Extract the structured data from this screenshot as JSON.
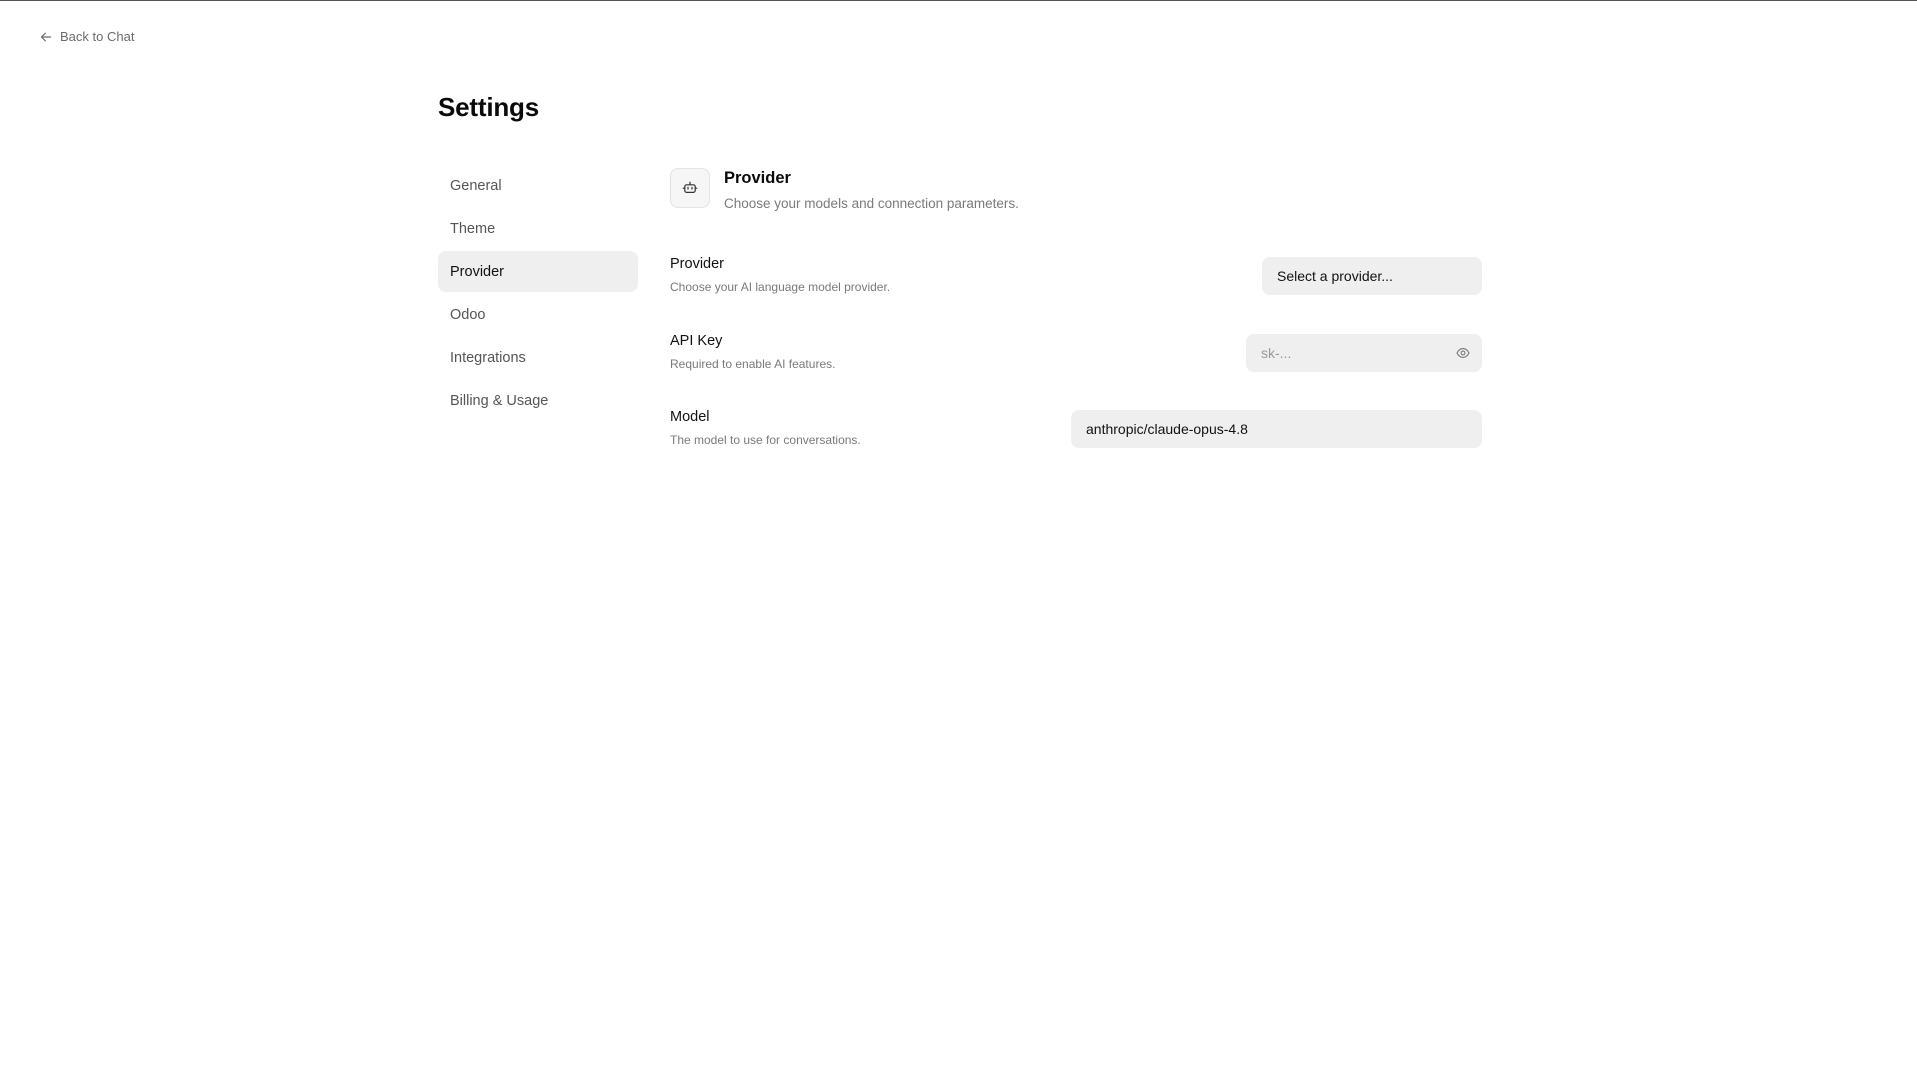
{
  "nav": {
    "back_label": "Back to Chat"
  },
  "page": {
    "title": "Settings"
  },
  "sidebar": {
    "items": [
      {
        "label": "General"
      },
      {
        "label": "Theme"
      },
      {
        "label": "Provider",
        "active": true
      },
      {
        "label": "Odoo"
      },
      {
        "label": "Integrations"
      },
      {
        "label": "Billing & Usage"
      }
    ]
  },
  "section": {
    "icon": "bot-icon",
    "title": "Provider",
    "description": "Choose your models and connection parameters."
  },
  "fields": {
    "provider": {
      "label": "Provider",
      "help": "Choose your AI language model provider.",
      "value": "Select a provider..."
    },
    "api_key": {
      "label": "API Key",
      "help": "Required to enable AI features.",
      "placeholder": "sk-...",
      "icon": "eye-icon"
    },
    "model": {
      "label": "Model",
      "help": "The model to use for conversations.",
      "value": "anthropic/claude-opus-4.8"
    }
  }
}
